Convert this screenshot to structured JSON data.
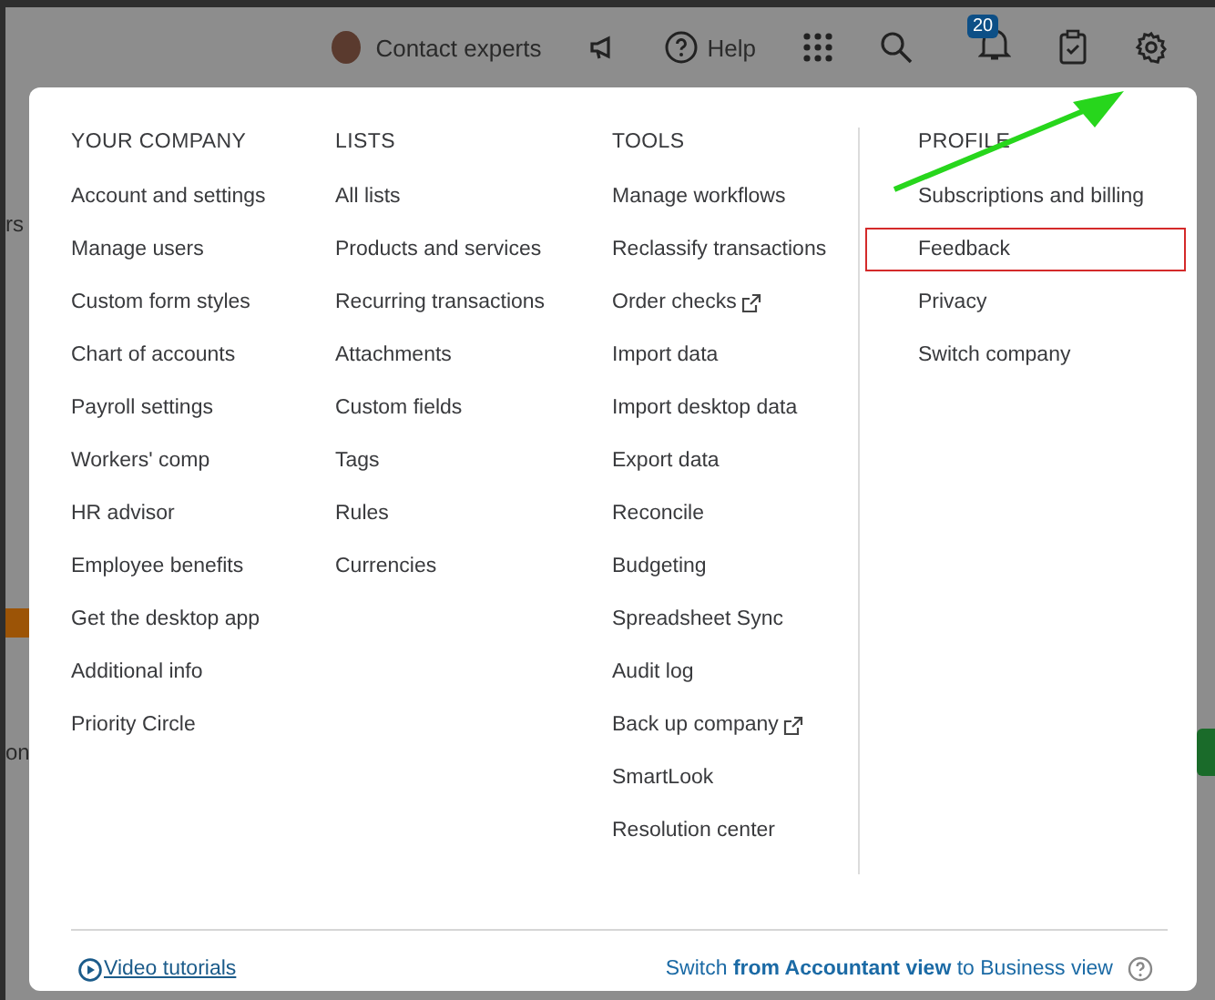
{
  "top_bar": {
    "contact": "Contact experts",
    "help": "Help",
    "notifications_badge": "20"
  },
  "background": {
    "texts": [
      "rs",
      "on"
    ]
  },
  "menu": {
    "columns": [
      {
        "heading": "YOUR COMPANY",
        "items": [
          {
            "label": "Account and settings",
            "external": false,
            "highlighted": false
          },
          {
            "label": "Manage users",
            "external": false,
            "highlighted": false
          },
          {
            "label": "Custom form styles",
            "external": false,
            "highlighted": false
          },
          {
            "label": "Chart of accounts",
            "external": false,
            "highlighted": false
          },
          {
            "label": "Payroll settings",
            "external": false,
            "highlighted": false
          },
          {
            "label": "Workers' comp",
            "external": false,
            "highlighted": false
          },
          {
            "label": "HR advisor",
            "external": false,
            "highlighted": false
          },
          {
            "label": "Employee benefits",
            "external": false,
            "highlighted": false
          },
          {
            "label": "Get the desktop app",
            "external": false,
            "highlighted": false
          },
          {
            "label": "Additional info",
            "external": false,
            "highlighted": false
          },
          {
            "label": "Priority Circle",
            "external": false,
            "highlighted": false
          }
        ]
      },
      {
        "heading": "LISTS",
        "items": [
          {
            "label": "All lists",
            "external": false,
            "highlighted": false
          },
          {
            "label": "Products and services",
            "external": false,
            "highlighted": false
          },
          {
            "label": "Recurring transactions",
            "external": false,
            "highlighted": false
          },
          {
            "label": "Attachments",
            "external": false,
            "highlighted": false
          },
          {
            "label": "Custom fields",
            "external": false,
            "highlighted": false
          },
          {
            "label": "Tags",
            "external": false,
            "highlighted": false
          },
          {
            "label": "Rules",
            "external": false,
            "highlighted": false
          },
          {
            "label": "Currencies",
            "external": false,
            "highlighted": false
          }
        ]
      },
      {
        "heading": "TOOLS",
        "items": [
          {
            "label": "Manage workflows",
            "external": false,
            "highlighted": false
          },
          {
            "label": "Reclassify transactions",
            "external": false,
            "highlighted": false
          },
          {
            "label": "Order checks",
            "external": true,
            "highlighted": false
          },
          {
            "label": "Import data",
            "external": false,
            "highlighted": false
          },
          {
            "label": "Import desktop data",
            "external": false,
            "highlighted": false
          },
          {
            "label": "Export data",
            "external": false,
            "highlighted": false
          },
          {
            "label": "Reconcile",
            "external": false,
            "highlighted": false
          },
          {
            "label": "Budgeting",
            "external": false,
            "highlighted": false
          },
          {
            "label": "Spreadsheet Sync",
            "external": false,
            "highlighted": false
          },
          {
            "label": "Audit log",
            "external": false,
            "highlighted": false
          },
          {
            "label": "Back up company",
            "external": true,
            "highlighted": false
          },
          {
            "label": "SmartLook",
            "external": false,
            "highlighted": false
          },
          {
            "label": "Resolution center",
            "external": false,
            "highlighted": false
          }
        ]
      },
      {
        "heading": "PROFILE",
        "items": [
          {
            "label": "Subscriptions and billing",
            "external": false,
            "highlighted": false
          },
          {
            "label": "Feedback",
            "external": false,
            "highlighted": true
          },
          {
            "label": "Privacy",
            "external": false,
            "highlighted": false
          },
          {
            "label": "Switch company",
            "external": false,
            "highlighted": false
          }
        ]
      }
    ],
    "footer": {
      "video_link": "Video tutorials",
      "switch_text": "Switch **from Accountant view** to Business view"
    }
  }
}
